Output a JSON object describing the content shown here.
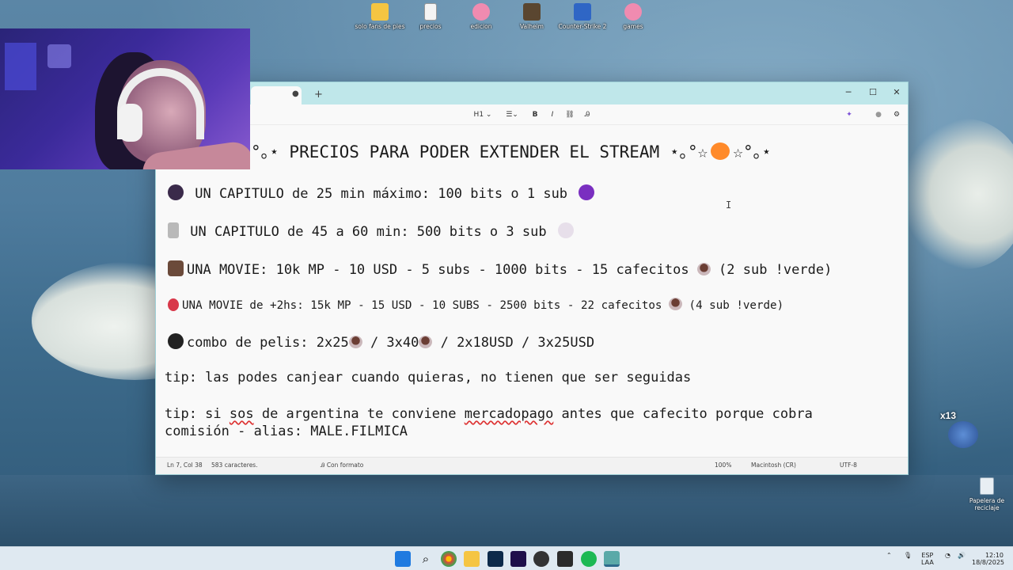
{
  "desktop": {
    "icons": [
      {
        "label": "solo fans de pies",
        "icon": "folder-icon",
        "color": "#f5c542"
      },
      {
        "label": "precios",
        "icon": "text-file-icon",
        "color": "#ffffff"
      },
      {
        "label": "edicion",
        "icon": "kirby-icon",
        "color": "#f08bb0"
      },
      {
        "label": "Valheim",
        "icon": "valheim-icon",
        "color": "#5a4630"
      },
      {
        "label": "Counter-Strike 2",
        "icon": "cs2-icon",
        "color": "#2f66c5"
      },
      {
        "label": "games",
        "icon": "kirby-icon",
        "color": "#f08bb0"
      }
    ],
    "recycle_bin": "Papelera de reciclaje",
    "badge": "x13"
  },
  "window": {
    "toolbar": {
      "heading": "H1",
      "bold": "B",
      "italic": "I"
    },
    "heading": "°｡⋆ PRECIOS PARA PODER EXTENDER EL STREAM ⋆｡°☆",
    "heading_tail": "☆°｡⋆",
    "lines": [
      {
        "emoji": "spider-icon",
        "text": " UN CAPITULO de 25 min máximo:  100 bits o 1 sub "
      },
      {
        "emoji": "knife-icon",
        "text": " UN CAPITULO de 45 a 60 min:  500 bits o 3 sub "
      },
      {
        "emoji": "bat-icon",
        "text": "UNA MOVIE: 10k MP - 10 USD - 5 subs - 1000 bits - 15 cafecitos ",
        "tail": " (2 sub !verde)"
      },
      {
        "emoji": "blood-drop-icon",
        "text": "UNA MOVIE de +2hs: 15k MP - 15 USD - 10 SUBS - 2500 bits - 22 cafecitos ",
        "tail": " (4 sub !verde)"
      },
      {
        "emoji": "black-heart-icon",
        "text": "combo de pelis: 2x25",
        "mid": " / 3x40",
        "tail": " / 2x18USD / 3x25USD"
      }
    ],
    "tip1": "tip: las podes canjear cuando quieras, no tienen que ser seguidas",
    "tip2_a": "tip: si ",
    "tip2_sos": "sos",
    "tip2_b": " de argentina te conviene ",
    "tip2_mp": "mercadopago",
    "tip2_c": " antes que cafecito porque cobra",
    "tip2_line2": "comisión - alias: MALE.FILMICA",
    "status": {
      "position": "Ln 7, Col 38",
      "chars": "583 caracteres.",
      "format": "Con formato",
      "zoom": "100%",
      "eol": "Macintosh (CR)",
      "encoding": "UTF-8"
    }
  },
  "taskbar": {
    "lang": "ESP",
    "lang2": "LAA",
    "time": "12:10",
    "date": "18/8/2025"
  }
}
